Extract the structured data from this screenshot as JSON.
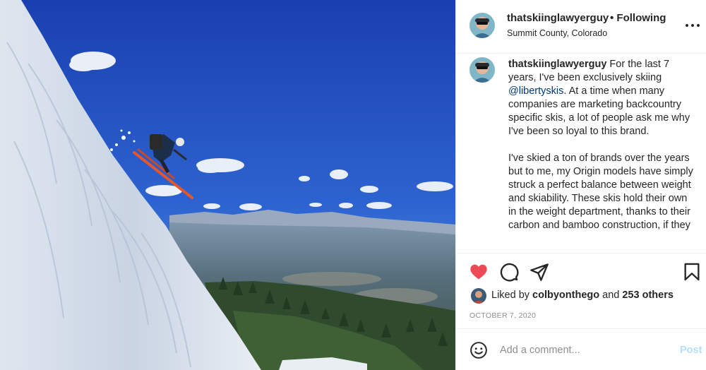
{
  "post": {
    "photo_alt": "Skier jumping off a snowy slope above a mountain valley",
    "header": {
      "username": "thatskiinglawyerguy",
      "follow_status": "• Following",
      "location": "Summit County, Colorado",
      "more_icon": "more-horizontal-icon"
    },
    "caption": {
      "username": "thatskiinglawyerguy",
      "p1_before": " For the last 7 years, I've been exclusively skiing ",
      "mention": "@libertyskis",
      "p1_after": ". At a time when many companies are marketing backcountry specific skis, a lot of people ask me why I've been so loyal to this brand.",
      "p2": "I've skied a ton of brands over the years but to me, my Origin models have simply struck a perfect balance between weight and skiability. These skis hold their own in the weight department, thanks to their carbon and bamboo construction, if they"
    },
    "actions": {
      "like_icon": "heart-filled-icon",
      "comment_icon": "comment-icon",
      "share_icon": "share-icon",
      "save_icon": "bookmark-icon",
      "liked_color": "#ed4956"
    },
    "likes": {
      "prefix": "Liked by ",
      "user": "colbyonthego",
      "middle": " and ",
      "others": "253 others"
    },
    "date": "OCTOBER 7, 2020",
    "comment": {
      "emoji_icon": "smiley-icon",
      "placeholder": "Add a comment...",
      "value": "",
      "post_label": "Post",
      "post_color": "#b2dffc"
    }
  }
}
